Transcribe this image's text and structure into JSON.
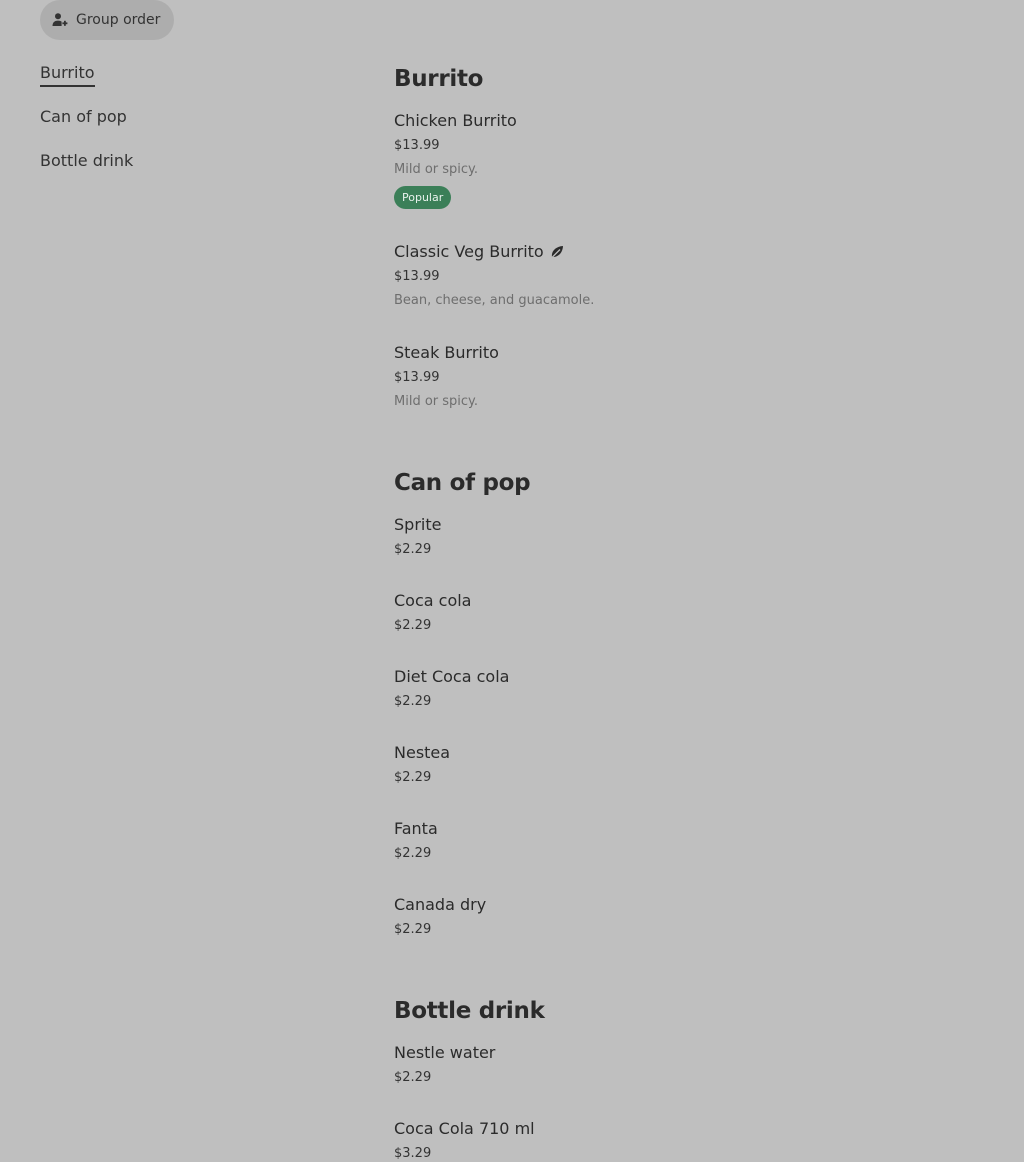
{
  "group_order": {
    "label": "Group order",
    "icon": "add-person-icon"
  },
  "nav": {
    "items": [
      {
        "label": "Burrito",
        "active": true
      },
      {
        "label": "Can of pop",
        "active": false
      },
      {
        "label": "Bottle drink",
        "active": false
      }
    ]
  },
  "sections": [
    {
      "title": "Burrito",
      "items": [
        {
          "name": "Chicken Burrito",
          "price": "$13.99",
          "description": "Mild or spicy.",
          "badge": "Popular"
        },
        {
          "name": "Classic Veg Burrito",
          "price": "$13.99",
          "description": "Bean, cheese, and guacamole.",
          "icon": "leaf-icon"
        },
        {
          "name": "Steak Burrito",
          "price": "$13.99",
          "description": "Mild or spicy."
        }
      ]
    },
    {
      "title": "Can of pop",
      "items": [
        {
          "name": "Sprite",
          "price": "$2.29"
        },
        {
          "name": "Coca cola",
          "price": "$2.29"
        },
        {
          "name": "Diet Coca cola",
          "price": "$2.29"
        },
        {
          "name": "Nestea",
          "price": "$2.29"
        },
        {
          "name": "Fanta",
          "price": "$2.29"
        },
        {
          "name": "Canada dry",
          "price": "$2.29"
        }
      ]
    },
    {
      "title": "Bottle drink",
      "items": [
        {
          "name": "Nestle water",
          "price": "$2.29"
        },
        {
          "name": "Coca Cola 710 ml",
          "price": "$3.29"
        }
      ]
    }
  ],
  "colors": {
    "background": "#bfbfbf",
    "badge": "#3b7f58",
    "text": "#2b2b2b"
  }
}
